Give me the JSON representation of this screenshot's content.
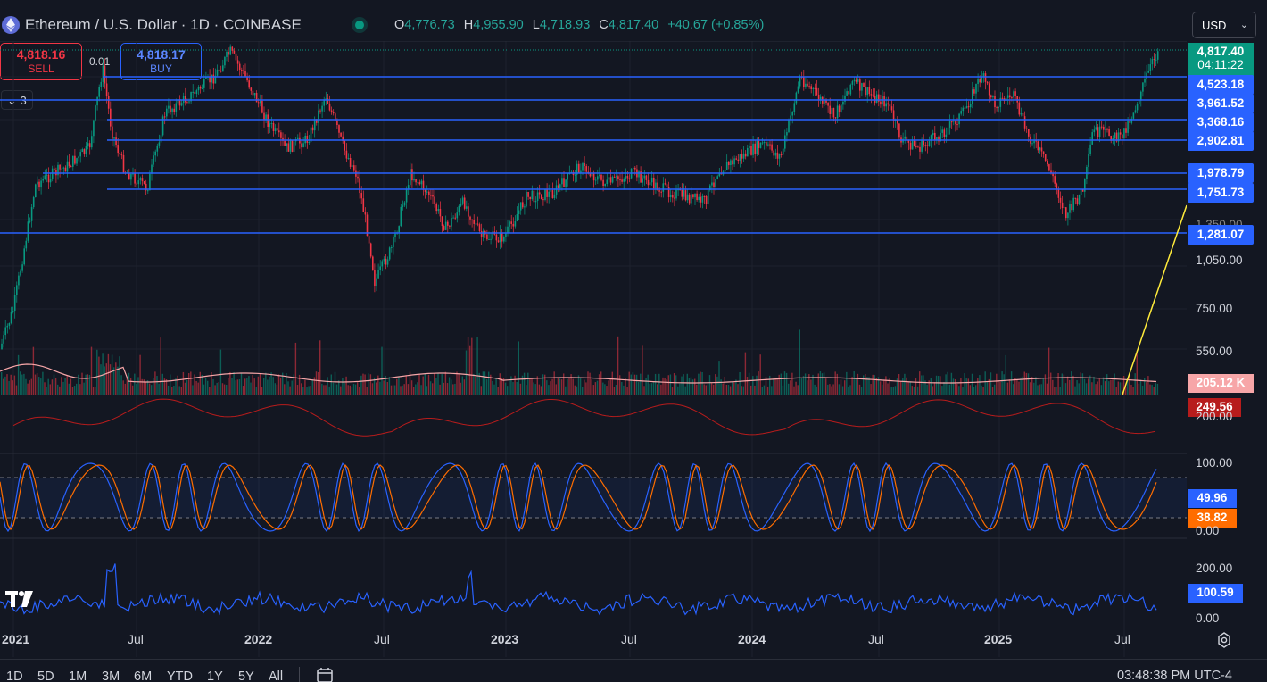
{
  "header": {
    "symbol_title": "Ethereum / U.S. Dollar · 1D · COINBASE",
    "ohlc": {
      "o_label": "O",
      "o_value": "4,776.73",
      "h_label": "H",
      "h_value": "4,955.90",
      "l_label": "L",
      "l_value": "4,718.93",
      "c_label": "C",
      "c_value": "4,817.40",
      "change": "+40.67 (+0.85%)"
    },
    "currency": "USD"
  },
  "trade": {
    "sell_price": "4,818.16",
    "sell_label": "SELL",
    "buy_price": "4,818.17",
    "buy_label": "BUY",
    "spread": "0.01"
  },
  "indicators_collapse": {
    "count": "3"
  },
  "price_axis": {
    "current_price": "4,817.40",
    "countdown": "04:11:22",
    "level_labels": [
      "4,523.18",
      "3,961.52",
      "3,368.16",
      "2,902.81",
      "1,978.79",
      "1,751.73",
      "1,281.07"
    ],
    "ticks": [
      "1,350.00",
      "1,050.00",
      "750.00",
      "550.00"
    ],
    "volume": "205.12 K",
    "atr_value": "249.56",
    "atr_tick": "200.00"
  },
  "stoch": {
    "top": "100.00",
    "bottom": "0.00",
    "k": "49.96",
    "d": "38.82"
  },
  "cci": {
    "top": "200.00",
    "bottom": "0.00",
    "value": "100.59"
  },
  "time_axis": [
    "2021",
    "Jul",
    "2022",
    "Jul",
    "2023",
    "Jul",
    "2024",
    "Jul",
    "2025",
    "Jul"
  ],
  "ranges": [
    "1D",
    "5D",
    "1M",
    "3M",
    "6M",
    "YTD",
    "1Y",
    "5Y",
    "All"
  ],
  "clock": "03:48:38 PM UTC-4",
  "colors": {
    "up": "#089981",
    "down": "#f23645",
    "level_line": "#2962ff",
    "trend_line": "#ffeb3b",
    "atr": "#b71c1c",
    "stoch_k": "#2962ff",
    "stoch_d": "#ff6d00"
  }
}
